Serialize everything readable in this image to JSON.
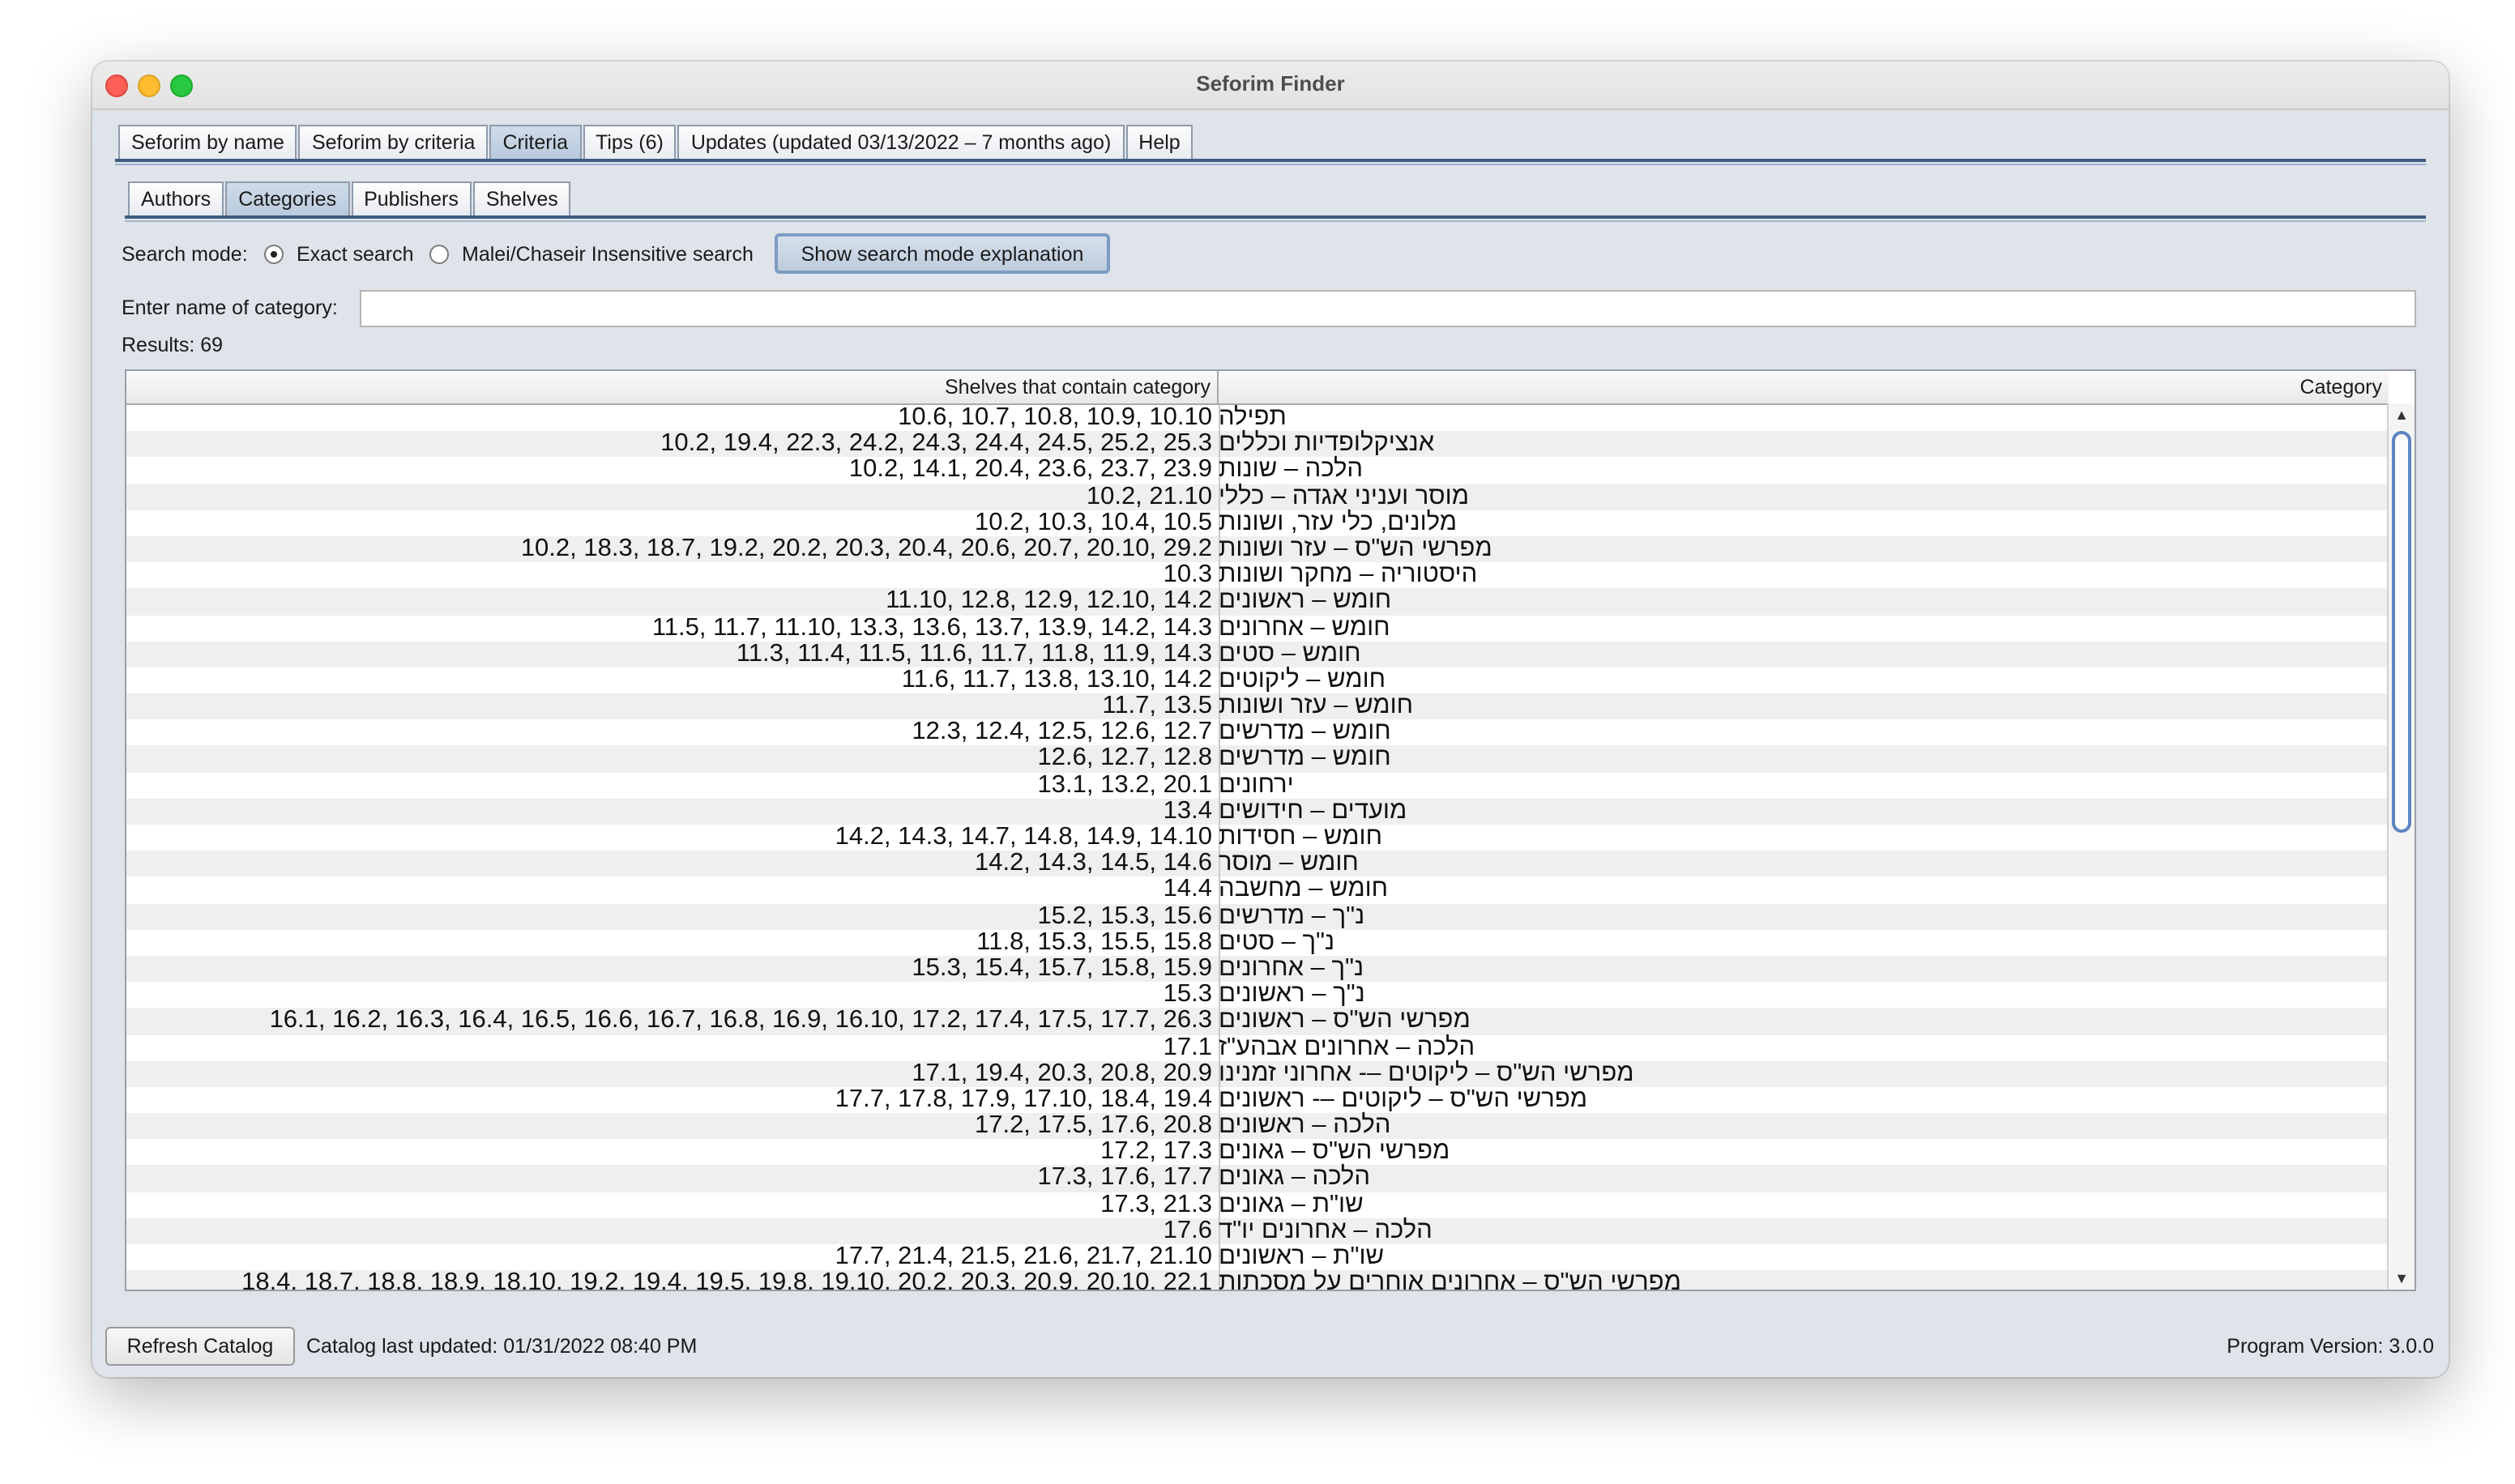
{
  "window": {
    "title": "Seforim Finder"
  },
  "main_tabs": [
    {
      "label": "Seforim by name",
      "active": false
    },
    {
      "label": "Seforim by criteria",
      "active": false
    },
    {
      "label": "Criteria",
      "active": true
    },
    {
      "label": "Tips (6)",
      "active": false
    },
    {
      "label": "Updates (updated 03/13/2022 – 7 months ago)",
      "active": false
    },
    {
      "label": "Help",
      "active": false
    }
  ],
  "sub_tabs": [
    {
      "label": "Authors",
      "active": false
    },
    {
      "label": "Categories",
      "active": true
    },
    {
      "label": "Publishers",
      "active": false
    },
    {
      "label": "Shelves",
      "active": false
    }
  ],
  "search": {
    "mode_label": "Search mode:",
    "exact_label": "Exact search",
    "malei_label": "Malei/Chaseir Insensitive search",
    "explain_button": "Show search mode explanation",
    "name_label": "Enter name of category:",
    "name_value": "",
    "results": "Results: 69"
  },
  "table": {
    "headers": {
      "shelves": "Shelves that contain category",
      "category": "Category"
    },
    "rows": [
      {
        "shelves": "10.6, 10.7, 10.8, 10.9, 10.10",
        "category": "תפילה"
      },
      {
        "shelves": "10.2, 19.4, 22.3, 24.2, 24.3, 24.4, 24.5, 25.2, 25.3",
        "category": "אנציקלופדיות וכללים"
      },
      {
        "shelves": "10.2, 14.1, 20.4, 23.6, 23.7, 23.9",
        "category": "הלכה – שונות"
      },
      {
        "shelves": "10.2, 21.10",
        "category": "מוסר ועניני אגדה – כללי"
      },
      {
        "shelves": "10.2, 10.3, 10.4, 10.5",
        "category": "מלונים, כלי עזר, ושונות"
      },
      {
        "shelves": "10.2, 18.3, 18.7, 19.2, 20.2, 20.3, 20.4, 20.6, 20.7, 20.10, 29.2",
        "category": "מפרשי הש\"ס – עזר ושונות"
      },
      {
        "shelves": "10.3",
        "category": "היסטוריה – מחקר ושונות"
      },
      {
        "shelves": "11.10, 12.8, 12.9, 12.10, 14.2",
        "category": "חומש – ראשונים"
      },
      {
        "shelves": "11.5, 11.7, 11.10, 13.3, 13.6, 13.7, 13.9, 14.2, 14.3",
        "category": "חומש – אחרונים"
      },
      {
        "shelves": "11.3, 11.4, 11.5, 11.6, 11.7, 11.8, 11.9, 14.3",
        "category": "חומש – סטים"
      },
      {
        "shelves": "11.6, 11.7, 13.8, 13.10, 14.2",
        "category": "חומש – ליקוטים"
      },
      {
        "shelves": "11.7, 13.5",
        "category": "חומש – עזר ושונות"
      },
      {
        "shelves": "12.3, 12.4, 12.5, 12.6, 12.7",
        "category": "חומש – מדרשים"
      },
      {
        "shelves": "12.6, 12.7, 12.8",
        "category": "חומש – מדרשים"
      },
      {
        "shelves": "13.1, 13.2, 20.1",
        "category": "ירחונים"
      },
      {
        "shelves": "13.4",
        "category": "מועדים – חידושים"
      },
      {
        "shelves": "14.2, 14.3, 14.7, 14.8, 14.9, 14.10",
        "category": "חומש – חסידות"
      },
      {
        "shelves": "14.2, 14.3, 14.5, 14.6",
        "category": "חומש – מוסר"
      },
      {
        "shelves": "14.4",
        "category": "חומש – מחשבה"
      },
      {
        "shelves": "15.2, 15.3, 15.6",
        "category": "נ\"ך – מדרשים"
      },
      {
        "shelves": "11.8, 15.3, 15.5, 15.8",
        "category": "נ\"ך – סטים"
      },
      {
        "shelves": "15.3, 15.4, 15.7, 15.8, 15.9",
        "category": "נ\"ך – אחרונים"
      },
      {
        "shelves": "15.3",
        "category": "נ\"ך – ראשונים"
      },
      {
        "shelves": "16.1, 16.2, 16.3, 16.4, 16.5, 16.6, 16.7, 16.8, 16.9, 16.10, 17.2, 17.4, 17.5, 17.7, 26.3",
        "category": "מפרשי הש\"ס – ראשונים"
      },
      {
        "shelves": "17.1",
        "category": "הלכה – אחרונים אבהע\"ז"
      },
      {
        "shelves": "17.1, 19.4, 20.3, 20.8, 20.9",
        "category": "מפרשי הש\"ס – ליקוטים –- אחרוני זמנינו"
      },
      {
        "shelves": "17.7, 17.8, 17.9, 17.10, 18.4, 19.4",
        "category": "מפרשי הש\"ס – ליקוטים –- ראשונים"
      },
      {
        "shelves": "17.2, 17.5, 17.6, 20.8",
        "category": "הלכה – ראשונים"
      },
      {
        "shelves": "17.2, 17.3",
        "category": "מפרשי הש\"ס – גאונים"
      },
      {
        "shelves": "17.3, 17.6, 17.7",
        "category": "הלכה – גאונים"
      },
      {
        "shelves": "17.3, 21.3",
        "category": "שו\"ת – גאונים"
      },
      {
        "shelves": "17.6",
        "category": "הלכה – אחרונים יו\"ד"
      },
      {
        "shelves": "17.7, 21.4, 21.5, 21.6, 21.7, 21.10",
        "category": "שו\"ת – ראשונים"
      },
      {
        "shelves": "18.4, 18.7, 18.8, 18.9, 18.10, 19.2, 19.4, 19.5, 19.8, 19.10, 20.2, 20.3, 20.9, 20.10, 22.1",
        "category": "מפרשי הש\"ס – אחרונים אוחרים על מסכתות"
      }
    ]
  },
  "footer": {
    "refresh_button": "Refresh Catalog",
    "last_updated": "Catalog last updated: 01/31/2022 08:40 PM",
    "version": "Program Version: 3.0.0"
  }
}
